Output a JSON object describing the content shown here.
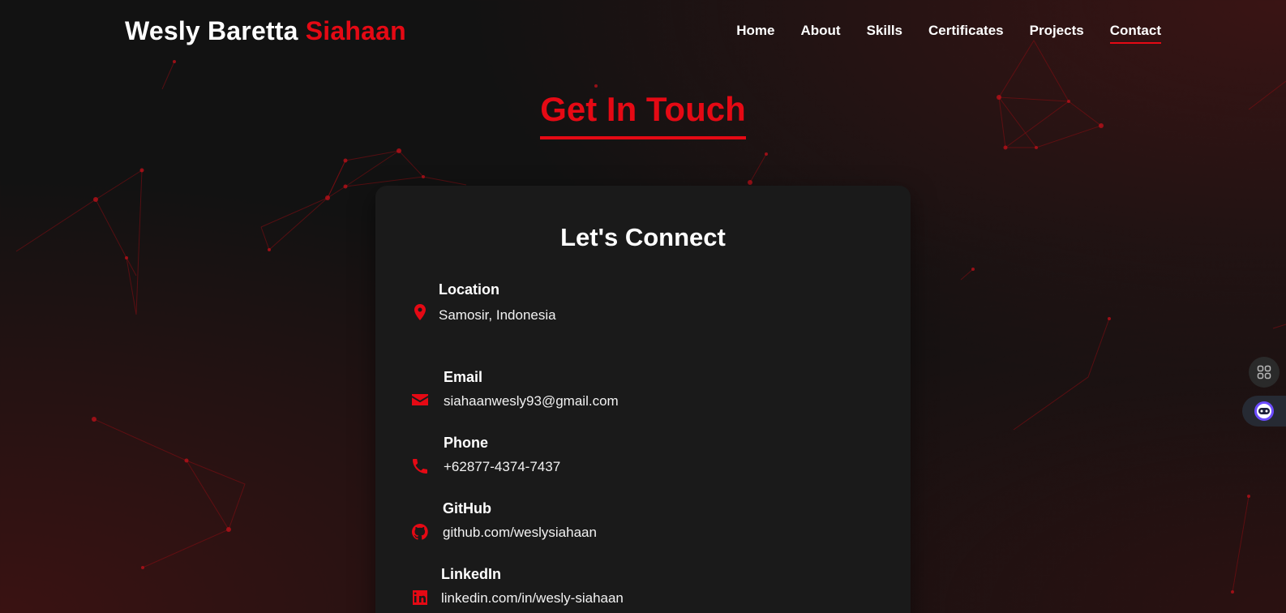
{
  "brand": {
    "first": "Wesly Baretta",
    "accent": "Siahaan"
  },
  "nav": {
    "items": [
      {
        "label": "Home",
        "active": false
      },
      {
        "label": "About",
        "active": false
      },
      {
        "label": "Skills",
        "active": false
      },
      {
        "label": "Certificates",
        "active": false
      },
      {
        "label": "Projects",
        "active": false
      },
      {
        "label": "Contact",
        "active": true
      }
    ]
  },
  "section": {
    "title": "Get In Touch"
  },
  "card": {
    "title": "Let's Connect",
    "items": [
      {
        "label": "Location",
        "value": "Samosir, Indonesia",
        "icon": "map-pin-icon"
      },
      {
        "label": "Email",
        "value": "siahaanwesly93@gmail.com",
        "icon": "envelope-icon"
      },
      {
        "label": "Phone",
        "value": "+62877-4374-7437",
        "icon": "phone-icon"
      },
      {
        "label": "GitHub",
        "value": "github.com/weslysiahaan",
        "icon": "github-icon"
      },
      {
        "label": "LinkedIn",
        "value": "linkedin.com/in/wesly-siahaan",
        "icon": "linkedin-icon"
      }
    ]
  },
  "side_buttons": {
    "apps_icon": "grid-icon",
    "assistant_icon": "assistant-icon"
  },
  "colors": {
    "accent": "#e50914",
    "background": "#121212",
    "card": "#1a1a1a"
  }
}
